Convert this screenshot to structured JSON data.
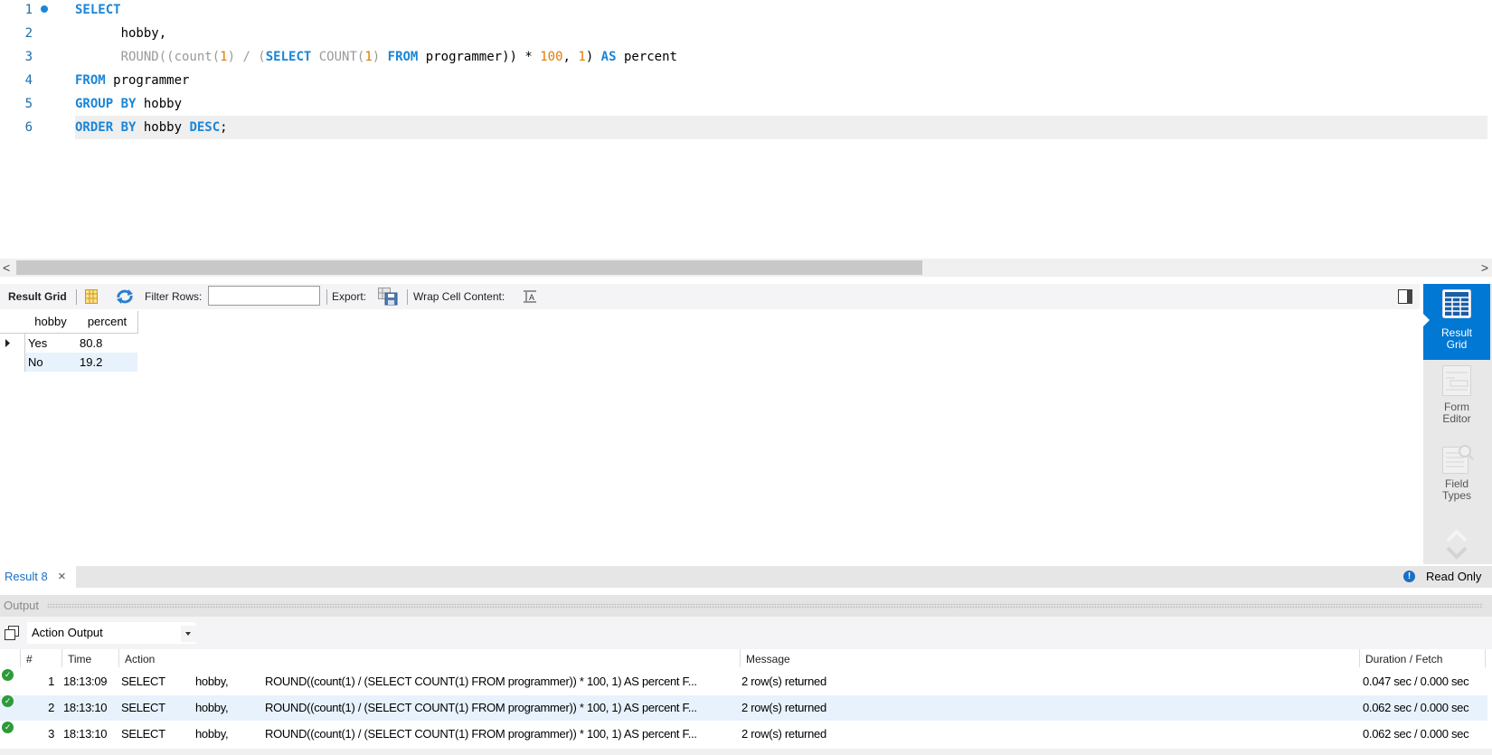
{
  "editor": {
    "lines": [
      {
        "num": "1",
        "tokens": [
          {
            "t": "SELECT",
            "c": "kw"
          }
        ]
      },
      {
        "num": "2",
        "tokens": [
          {
            "t": "      hobby,",
            "c": "id"
          }
        ]
      },
      {
        "num": "3",
        "tokens": [
          {
            "t": "      ROUND((count(",
            "c": "fn"
          },
          {
            "t": "1",
            "c": "num"
          },
          {
            "t": ") / (",
            "c": "fn"
          },
          {
            "t": "SELECT",
            "c": "kw"
          },
          {
            "t": " COUNT(",
            "c": "fn"
          },
          {
            "t": "1",
            "c": "num"
          },
          {
            "t": ") ",
            "c": "fn"
          },
          {
            "t": "FROM",
            "c": "kw"
          },
          {
            "t": " programmer)) * ",
            "c": "id"
          },
          {
            "t": "100",
            "c": "num"
          },
          {
            "t": ", ",
            "c": "id"
          },
          {
            "t": "1",
            "c": "num"
          },
          {
            "t": ") ",
            "c": "id"
          },
          {
            "t": "AS",
            "c": "kw"
          },
          {
            "t": " percent",
            "c": "id"
          }
        ]
      },
      {
        "num": "4",
        "tokens": [
          {
            "t": "FROM",
            "c": "kw"
          },
          {
            "t": " programmer",
            "c": "id"
          }
        ]
      },
      {
        "num": "5",
        "tokens": [
          {
            "t": "GROUP BY",
            "c": "kw"
          },
          {
            "t": " hobby",
            "c": "id"
          }
        ]
      },
      {
        "num": "6",
        "tokens": [
          {
            "t": "ORDER BY",
            "c": "kw"
          },
          {
            "t": " hobby ",
            "c": "id"
          },
          {
            "t": "DESC",
            "c": "kw"
          },
          {
            "t": ";",
            "c": "id"
          }
        ]
      }
    ],
    "scroll_left": "<",
    "scroll_right": ">"
  },
  "result_toolbar": {
    "result_grid_label": "Result Grid",
    "filter_rows_label": "Filter Rows:",
    "filter_rows_value": "",
    "export_label": "Export:",
    "wrap_label": "Wrap Cell Content:"
  },
  "grid": {
    "columns": [
      "hobby",
      "percent"
    ],
    "rows": [
      [
        "Yes",
        "80.8"
      ],
      [
        "No",
        "19.2"
      ]
    ]
  },
  "side_panel": {
    "items": [
      {
        "label1": "Result",
        "label2": "Grid",
        "active": true
      },
      {
        "label1": "Form",
        "label2": "Editor",
        "active": false
      },
      {
        "label1": "Field",
        "label2": "Types",
        "active": false
      }
    ]
  },
  "result_tab": {
    "label": "Result 8",
    "close": "×",
    "read_only": "Read Only"
  },
  "output": {
    "title": "Output",
    "selector": "Action Output",
    "columns": [
      "#",
      "Time",
      "Action",
      "Message",
      "Duration / Fetch"
    ],
    "rows": [
      {
        "n": "1",
        "time": "18:13:09",
        "action": "SELECT",
        "a2": "hobby,",
        "a3": "ROUND((count(1) / (SELECT COUNT(1) FROM programmer)) * 100, 1) AS percent  F...",
        "msg": "2 row(s) returned",
        "dur": "0.047 sec / 0.000 sec"
      },
      {
        "n": "2",
        "time": "18:13:10",
        "action": "SELECT",
        "a2": "hobby,",
        "a3": "ROUND((count(1) / (SELECT COUNT(1) FROM programmer)) * 100, 1) AS percent  F...",
        "msg": "2 row(s) returned",
        "dur": "0.062 sec / 0.000 sec"
      },
      {
        "n": "3",
        "time": "18:13:10",
        "action": "SELECT",
        "a2": "hobby,",
        "a3": "ROUND((count(1) / (SELECT COUNT(1) FROM programmer)) * 100, 1) AS percent  F...",
        "msg": "2 row(s) returned",
        "dur": "0.062 sec / 0.000 sec"
      }
    ]
  },
  "colors": {
    "accent": "#0078d4",
    "keyword": "#1a86d8",
    "number": "#e07b00",
    "success": "#2e9a3a"
  }
}
